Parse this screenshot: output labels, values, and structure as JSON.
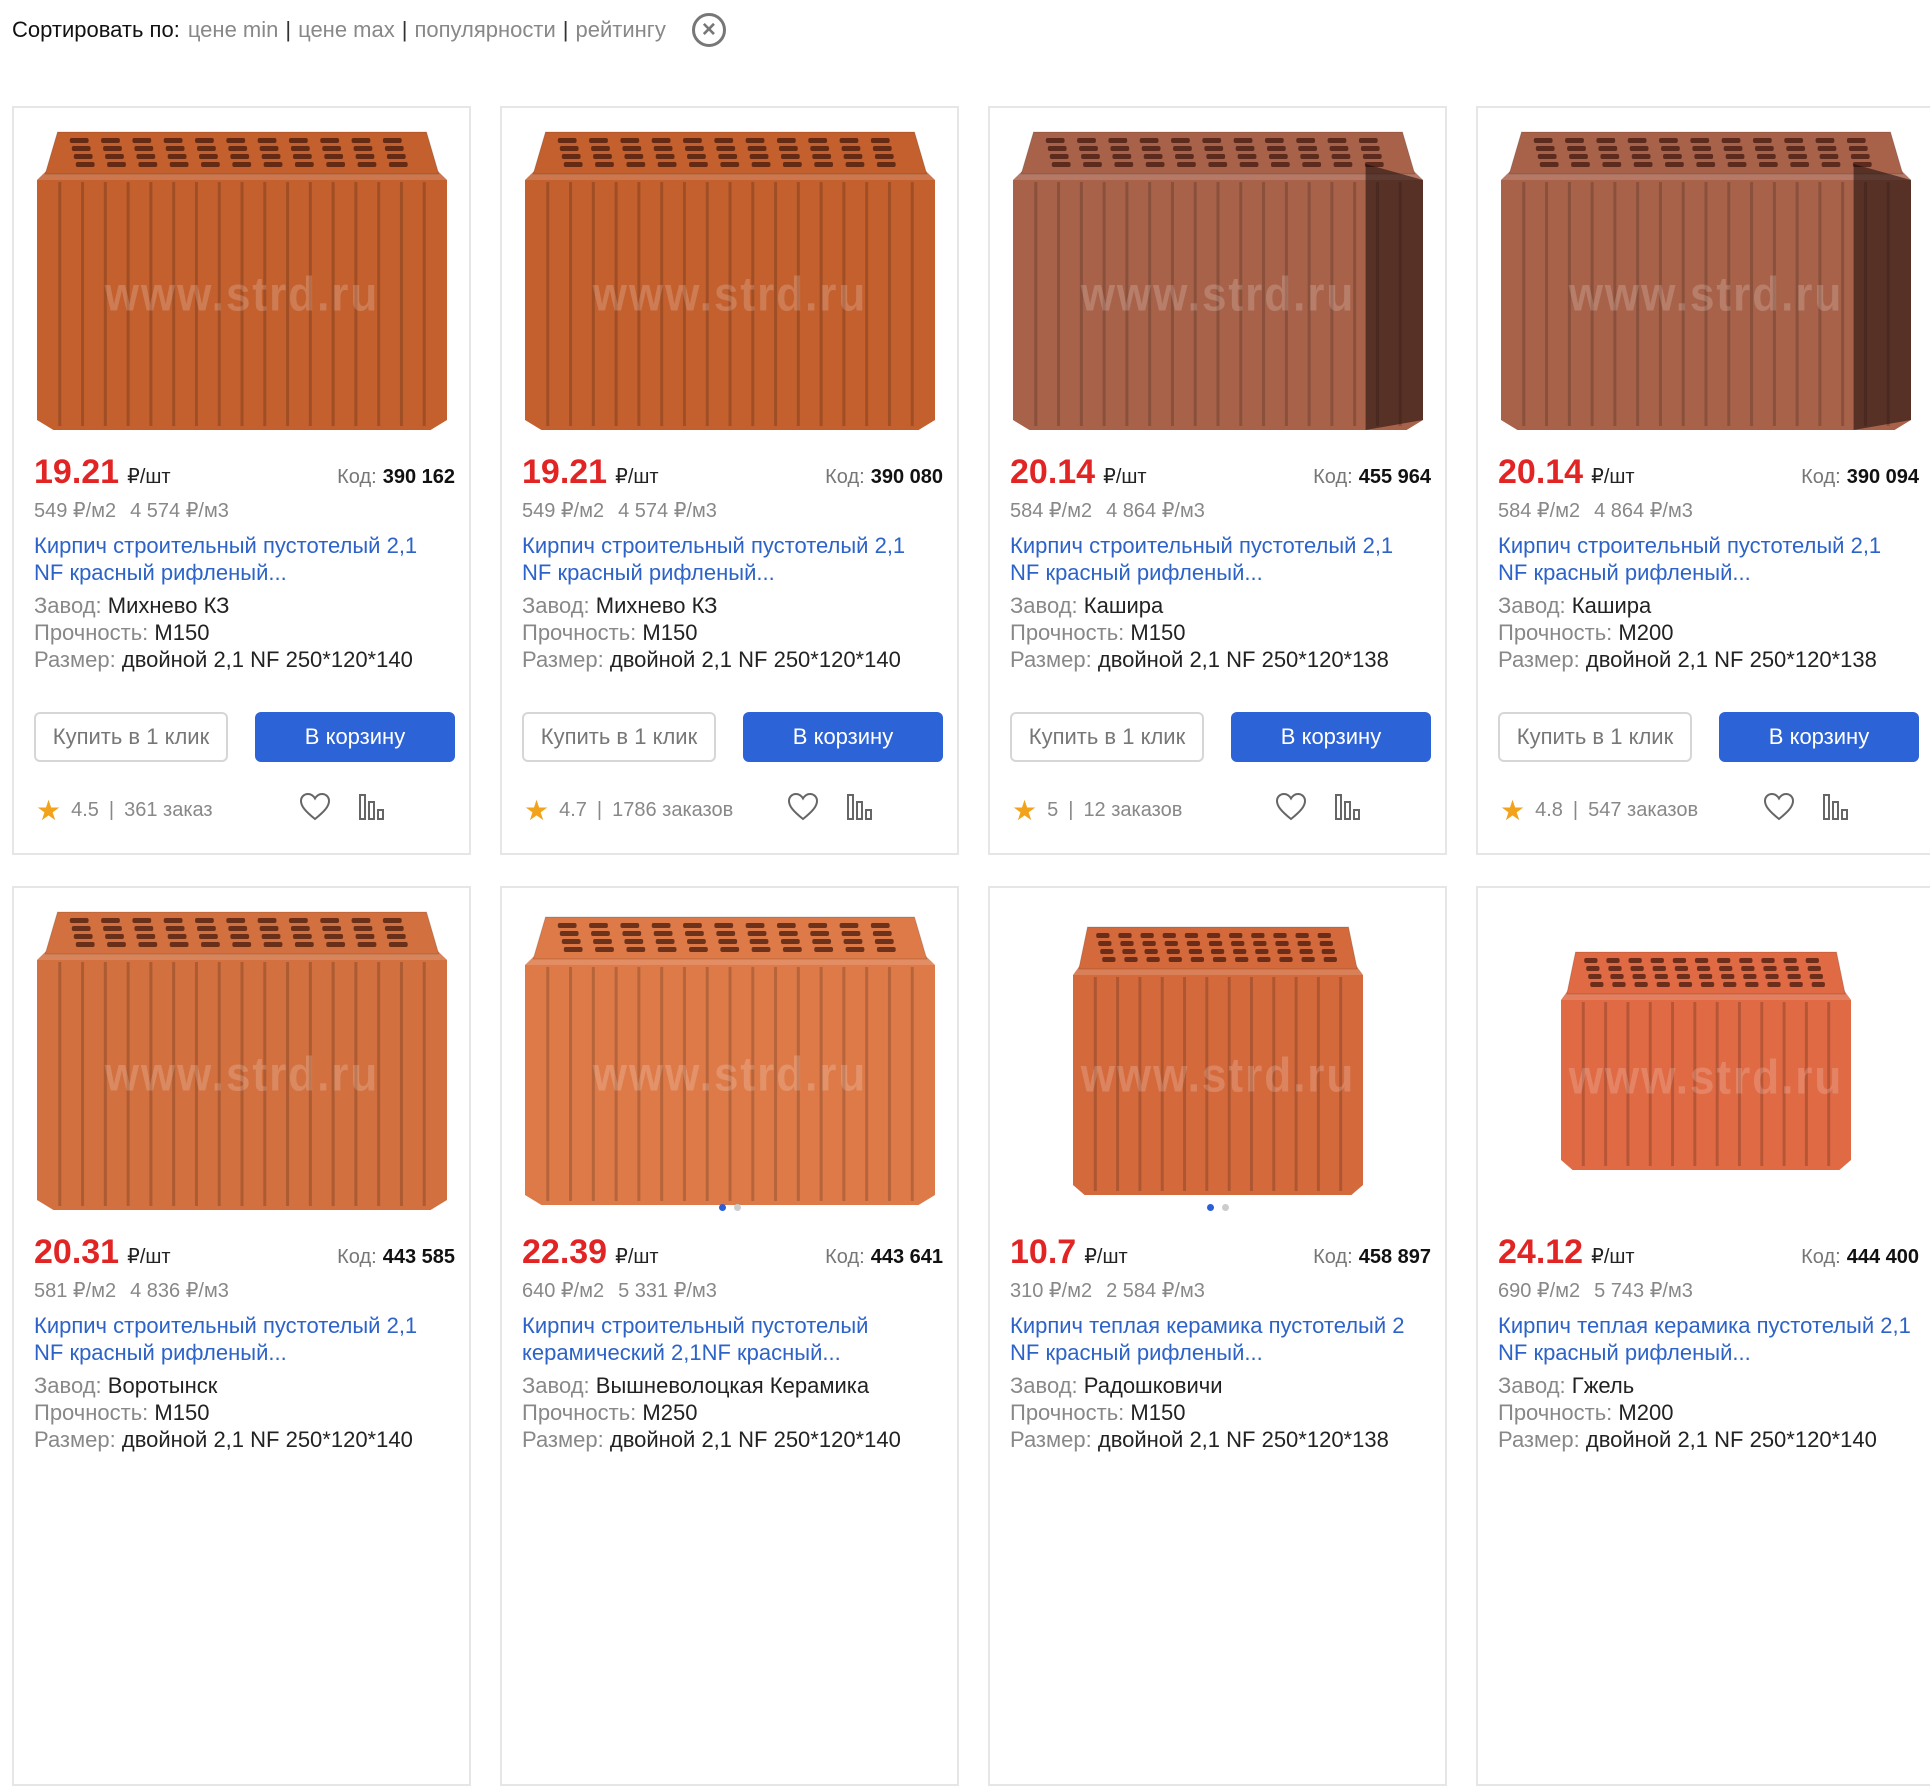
{
  "sort": {
    "label": "Сортировать по:",
    "options": [
      "цене min",
      "цене max",
      "популярности",
      "рейтингу"
    ],
    "clear_icon": "close-circle-icon"
  },
  "labels": {
    "code": "Код:",
    "factory": "Завод:",
    "strength": "Прочность:",
    "size": "Размер:",
    "buy_one_click": "Купить в 1 клик",
    "add_to_cart": "В корзину",
    "watermark": "www.strd.ru"
  },
  "products": [
    {
      "price": "19.21",
      "unit": "₽/шт",
      "code": "390 162",
      "per_m2": "549 ₽/м2",
      "per_m3": "4 574 ₽/м3",
      "title": "Кирпич строительный пустотелый 2,1 NF красный рифленый...",
      "factory": "Михнево КЗ",
      "strength": "М150",
      "size": "двойной 2,1 NF 250*120*140",
      "rating": "4.5",
      "orders": "361 заказ",
      "color": "#c4602e"
    },
    {
      "price": "19.21",
      "unit": "₽/шт",
      "code": "390 080",
      "per_m2": "549 ₽/м2",
      "per_m3": "4 574 ₽/м3",
      "title": "Кирпич строительный пустотелый 2,1 NF красный рифленый...",
      "factory": "Михнево КЗ",
      "strength": "М150",
      "size": "двойной 2,1 NF 250*120*140",
      "rating": "4.7",
      "orders": "1786 заказов",
      "color": "#c4602e"
    },
    {
      "price": "20.14",
      "unit": "₽/шт",
      "code": "455 964",
      "per_m2": "584 ₽/м2",
      "per_m3": "4 864 ₽/м3",
      "title": "Кирпич строительный пустотелый 2,1 NF красный рифленый...",
      "factory": "Кашира",
      "strength": "М150",
      "size": "двойной 2,1 NF 250*120*138",
      "rating": "5",
      "orders": "12 заказов",
      "color": "#a8624a"
    },
    {
      "price": "20.14",
      "unit": "₽/шт",
      "code": "390 094",
      "per_m2": "584 ₽/м2",
      "per_m3": "4 864 ₽/м3",
      "title": "Кирпич строительный пустотелый 2,1 NF красный рифленый...",
      "factory": "Кашира",
      "strength": "М200",
      "size": "двойной 2,1 NF 250*120*138",
      "rating": "4.8",
      "orders": "547 заказов",
      "color": "#a8624a"
    },
    {
      "price": "20.31",
      "unit": "₽/шт",
      "code": "443 585",
      "per_m2": "581 ₽/м2",
      "per_m3": "4 836 ₽/м3",
      "title": "Кирпич строительный пустотелый 2,1 NF красный рифленый...",
      "factory": "Воротынск",
      "strength": "М150",
      "size": "двойной 2,1 NF 250*120*140",
      "color": "#d2703f"
    },
    {
      "price": "22.39",
      "unit": "₽/шт",
      "code": "443 641",
      "per_m2": "640 ₽/м2",
      "per_m3": "5 331 ₽/м3",
      "title": "Кирпич строительный пустотелый керамический 2,1NF красный...",
      "factory": "Вышневолоцкая Керамика",
      "strength": "М250",
      "size": "двойной 2,1 NF 250*120*140",
      "color": "#dd7a48"
    },
    {
      "price": "10.7",
      "unit": "₽/шт",
      "code": "458 897",
      "per_m2": "310 ₽/м2",
      "per_m3": "2 584 ₽/м3",
      "title": "Кирпич теплая керамика пустотелый 2 NF красный рифленый...",
      "factory": "Радошковичи",
      "strength": "М150",
      "size": "двойной 2,1 NF 250*120*138",
      "color": "#d46a3c"
    },
    {
      "price": "24.12",
      "unit": "₽/шт",
      "code": "444 400",
      "per_m2": "690 ₽/м2",
      "per_m3": "5 743 ₽/м3",
      "title": "Кирпич теплая керамика пустотелый 2,1 NF красный рифленый...",
      "factory": "Гжель",
      "strength": "М200",
      "size": "двойной 2,1 NF 250*120*140",
      "color": "#e06a44"
    }
  ]
}
